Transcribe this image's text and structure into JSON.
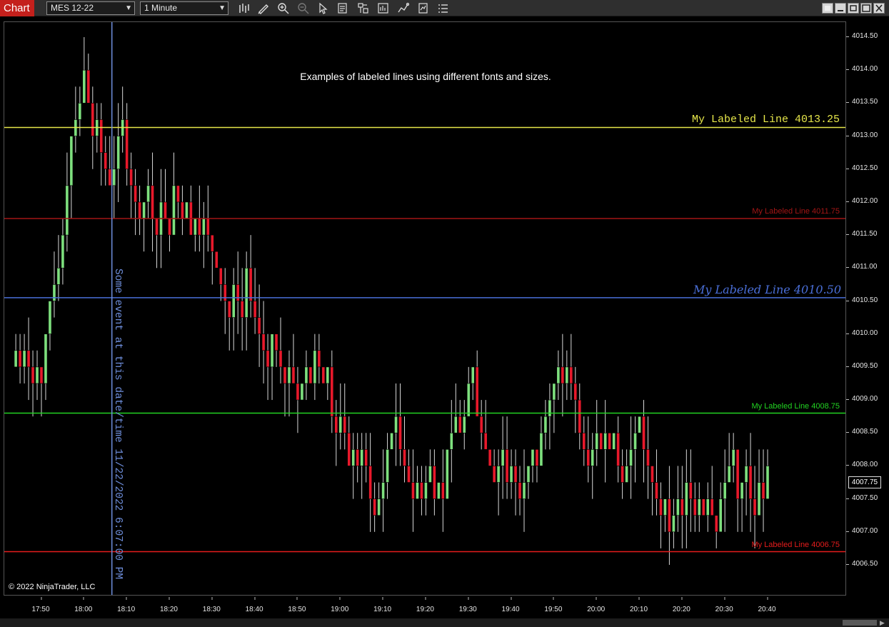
{
  "window": {
    "title": "Chart"
  },
  "toolbar": {
    "instrument": "MES 12-22",
    "interval": "1 Minute",
    "icons": [
      "bar-type-icon",
      "pencil-draw-icon",
      "zoom-in-icon",
      "zoom-out-icon",
      "pointer-icon",
      "data-box-icon",
      "chart-trader-icon",
      "indicators-icon",
      "strategies-icon",
      "templates-icon",
      "properties-icon"
    ]
  },
  "chart": {
    "annotation": "Examples of labeled lines using different fonts and sizes.",
    "copyright": "© 2022 NinjaTrader, LLC",
    "vertical_line_label": "Some event at this date/time 11/22/2022 6:07:00 PM",
    "last_price": "4007.75",
    "price_ticks": [
      "4014.50",
      "4014.00",
      "4013.50",
      "4013.00",
      "4012.50",
      "4012.00",
      "4011.50",
      "4011.00",
      "4010.50",
      "4010.00",
      "4009.50",
      "4009.00",
      "4008.50",
      "4008.00",
      "4007.50",
      "4007.00",
      "4006.50"
    ],
    "time_ticks": [
      "17:50",
      "18:00",
      "18:10",
      "18:20",
      "18:30",
      "18:40",
      "18:50",
      "19:00",
      "19:10",
      "19:20",
      "19:30",
      "19:40",
      "19:50",
      "20:00",
      "20:10",
      "20:20",
      "20:30",
      "20:40"
    ],
    "labeled_lines": [
      {
        "label": "My Labeled Line 4013.25",
        "price": 4013.13,
        "color": "#e6e64a"
      },
      {
        "label": "My Labeled Line 4011.75",
        "price": 4011.75,
        "color": "#a31515"
      },
      {
        "label": "My Labeled Line 4010.50",
        "price": 4010.55,
        "color": "#4a6fd8"
      },
      {
        "label": "My Labeled Line 4008.75",
        "price": 4008.8,
        "color": "#22d322"
      },
      {
        "label": "My Labeled Line 4006.75",
        "price": 4006.7,
        "color": "#e61c1c"
      }
    ],
    "colors": {
      "up": "#7ee07e",
      "down": "#e8192b",
      "wick": "#d8d8d8"
    }
  }
}
